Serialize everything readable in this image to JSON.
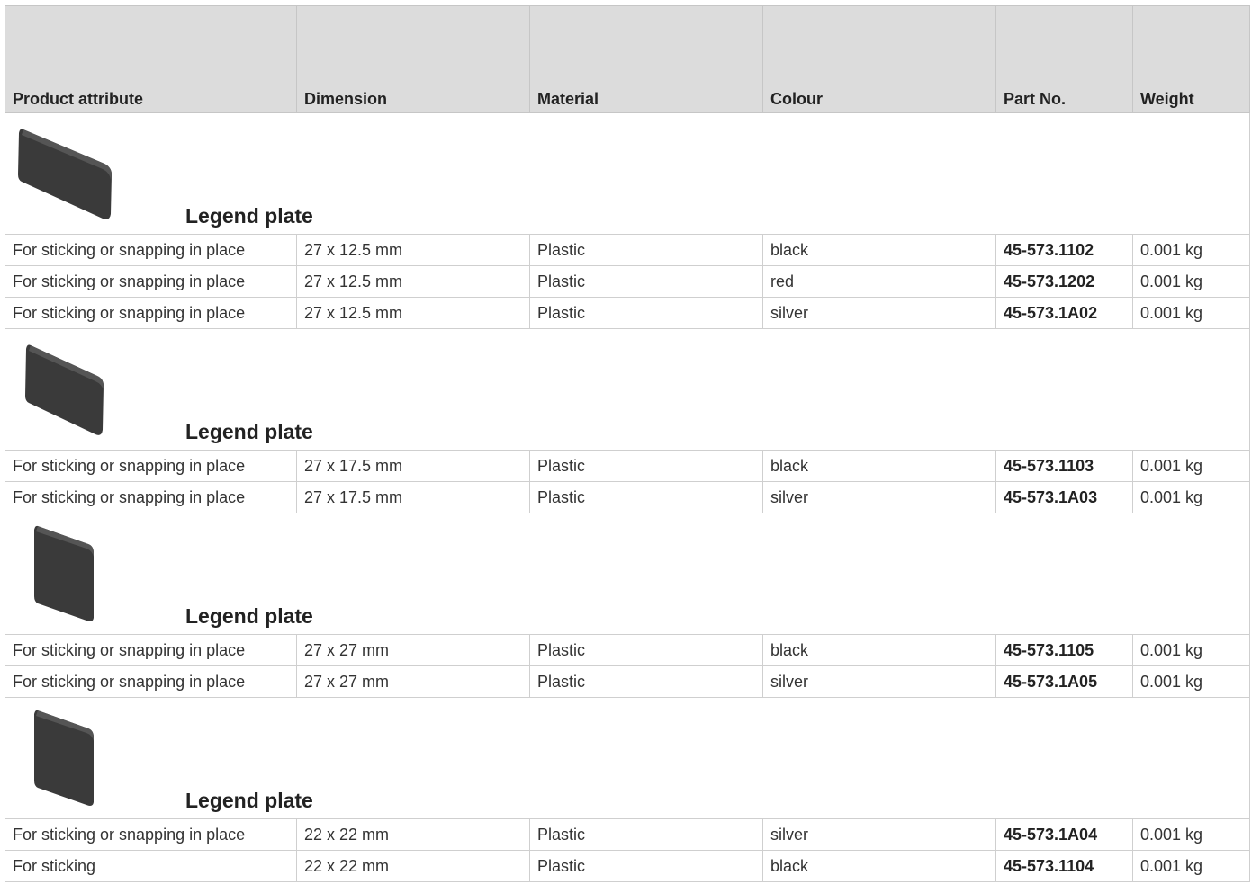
{
  "columns": [
    "Product attribute",
    "Dimension",
    "Material",
    "Colour",
    "Part No.",
    "Weight"
  ],
  "sections": [
    {
      "title": "Legend plate",
      "icon": "legend-plate-wide-icon",
      "rows": [
        {
          "attribute": "For sticking or snapping in place",
          "dimension": "27 x 12.5 mm",
          "material": "Plastic",
          "colour": "black",
          "part_no": "45-573.1102",
          "weight": "0.001 kg"
        },
        {
          "attribute": "For sticking or snapping in place",
          "dimension": "27 x 12.5 mm",
          "material": "Plastic",
          "colour": "red",
          "part_no": "45-573.1202",
          "weight": "0.001 kg"
        },
        {
          "attribute": "For sticking or snapping in place",
          "dimension": "27 x 12.5 mm",
          "material": "Plastic",
          "colour": "silver",
          "part_no": "45-573.1A02",
          "weight": "0.001 kg"
        }
      ]
    },
    {
      "title": "Legend plate",
      "icon": "legend-plate-medium-icon",
      "rows": [
        {
          "attribute": "For sticking or snapping in place",
          "dimension": "27 x 17.5 mm",
          "material": "Plastic",
          "colour": "black",
          "part_no": "45-573.1103",
          "weight": "0.001 kg"
        },
        {
          "attribute": "For sticking or snapping in place",
          "dimension": "27 x 17.5 mm",
          "material": "Plastic",
          "colour": "silver",
          "part_no": "45-573.1A03",
          "weight": "0.001 kg"
        }
      ]
    },
    {
      "title": "Legend plate",
      "icon": "legend-plate-square-icon",
      "rows": [
        {
          "attribute": "For sticking or snapping in place",
          "dimension": "27 x 27 mm",
          "material": "Plastic",
          "colour": "black",
          "part_no": "45-573.1105",
          "weight": "0.001 kg"
        },
        {
          "attribute": "For sticking or snapping in place",
          "dimension": "27 x 27 mm",
          "material": "Plastic",
          "colour": "silver",
          "part_no": "45-573.1A05",
          "weight": "0.001 kg"
        }
      ]
    },
    {
      "title": "Legend plate",
      "icon": "legend-plate-small-square-icon",
      "rows": [
        {
          "attribute": "For sticking or snapping in place",
          "dimension": "22 x 22 mm",
          "material": "Plastic",
          "colour": "silver",
          "part_no": "45-573.1A04",
          "weight": "0.001 kg"
        },
        {
          "attribute": "For sticking",
          "dimension": "22 x 22 mm",
          "material": "Plastic",
          "colour": "black",
          "part_no": "45-573.1104",
          "weight": "0.001 kg"
        }
      ]
    }
  ],
  "colors": {
    "header_bg": "#dcdcdc",
    "border": "#cfcfcf",
    "plate": "#3a3a3a"
  }
}
